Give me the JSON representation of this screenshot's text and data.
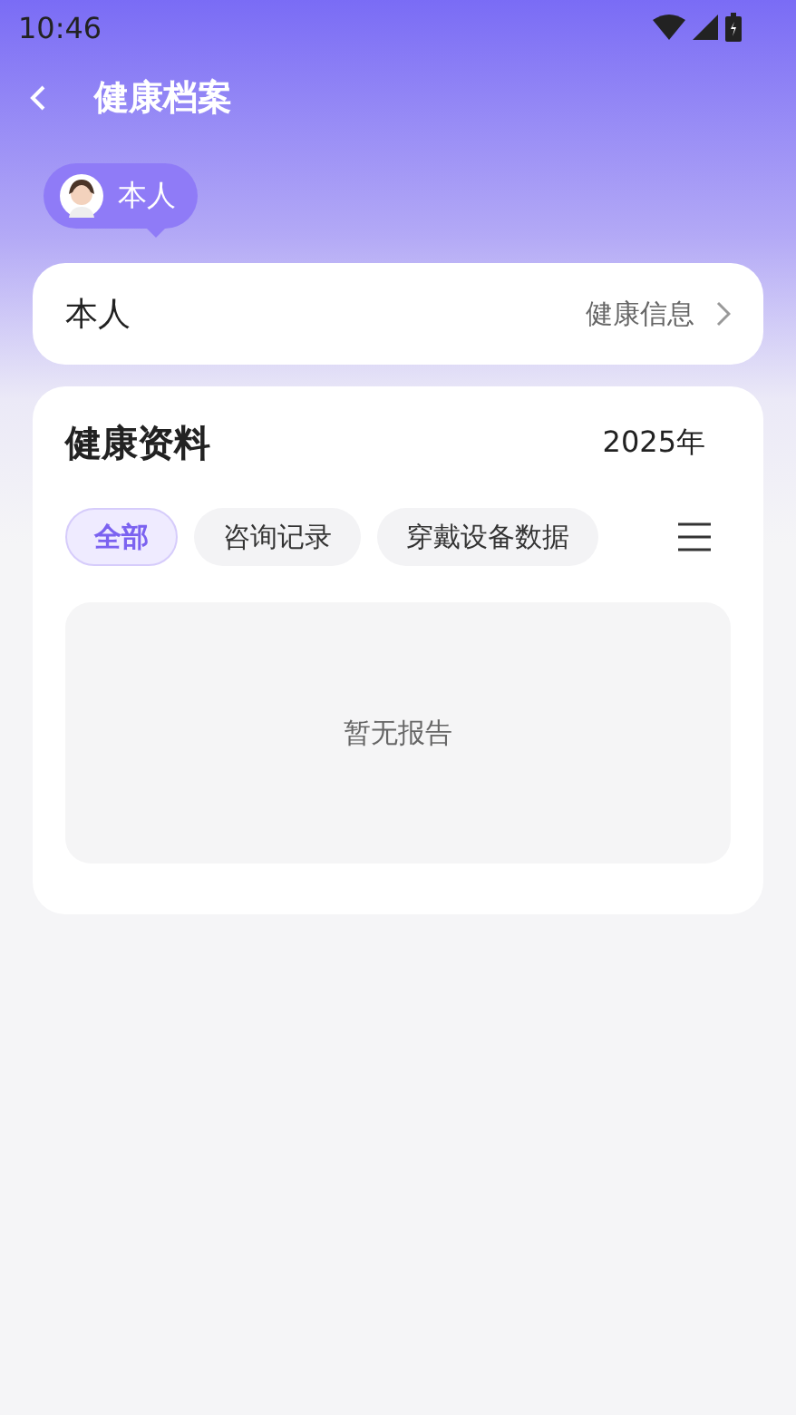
{
  "status_bar": {
    "time": "10:46"
  },
  "header": {
    "title": "健康档案"
  },
  "profile_bubble": {
    "label": "本人"
  },
  "member_card": {
    "name": "本人",
    "link": "健康信息"
  },
  "records": {
    "title": "健康资料",
    "year": "2025年",
    "tabs": [
      {
        "label": "全部",
        "selected": true
      },
      {
        "label": "咨询记录",
        "selected": false
      },
      {
        "label": "穿戴设备数据",
        "selected": false
      }
    ],
    "empty_text": "暂无报告"
  }
}
